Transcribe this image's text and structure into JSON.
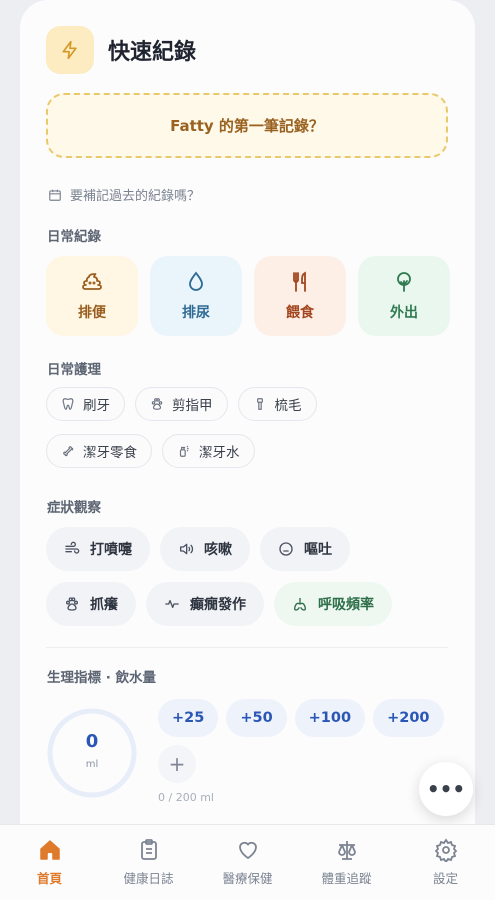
{
  "header": {
    "title": "快速紀錄",
    "icon": "bolt-icon"
  },
  "first_record": {
    "label": "Fatty 的第一筆記錄？"
  },
  "backfill": {
    "label": "要補記過去的紀錄嗎？",
    "icon": "calendar-icon"
  },
  "daily": {
    "title": "日常紀錄",
    "items": [
      {
        "label": "排便",
        "icon": "poop-icon"
      },
      {
        "label": "排尿",
        "icon": "droplet-icon"
      },
      {
        "label": "餵食",
        "icon": "utensils-icon"
      },
      {
        "label": "外出",
        "icon": "tree-icon"
      }
    ]
  },
  "care": {
    "title": "日常護理",
    "items": [
      {
        "label": "刷牙",
        "icon": "tooth-icon"
      },
      {
        "label": "剪指甲",
        "icon": "paw-icon"
      },
      {
        "label": "梳毛",
        "icon": "brush-icon"
      },
      {
        "label": "潔牙零食",
        "icon": "bone-icon"
      },
      {
        "label": "潔牙水",
        "icon": "spray-icon"
      }
    ]
  },
  "symptoms": {
    "title": "症狀觀察",
    "items": [
      {
        "label": "打噴嚏",
        "icon": "wind-icon"
      },
      {
        "label": "咳嗽",
        "icon": "speaker-icon"
      },
      {
        "label": "嘔吐",
        "icon": "sick-face-icon"
      },
      {
        "label": "抓癢",
        "icon": "paw-icon"
      },
      {
        "label": "癲癇發作",
        "icon": "pulse-icon"
      },
      {
        "label": "呼吸頻率",
        "icon": "lungs-icon"
      }
    ]
  },
  "water": {
    "title": "生理指標 · 飲水量",
    "value": "0",
    "unit": "ml",
    "progress": "0 / 200 ml",
    "progress_fraction": 0,
    "buttons": [
      "+25",
      "+50",
      "+100",
      "+200"
    ],
    "custom": "+"
  },
  "fab": {
    "label": "•••"
  },
  "tabs": [
    {
      "label": "首頁",
      "icon": "home-icon",
      "active": true
    },
    {
      "label": "健康日誌",
      "icon": "clipboard-icon"
    },
    {
      "label": "醫療保健",
      "icon": "heart-icon"
    },
    {
      "label": "體重追蹤",
      "icon": "scale-icon"
    },
    {
      "label": "設定",
      "icon": "gear-icon"
    }
  ],
  "colors": {
    "accent": "#e07a2b",
    "water": "#2a57b6",
    "first_record_border": "#e9c96c"
  }
}
